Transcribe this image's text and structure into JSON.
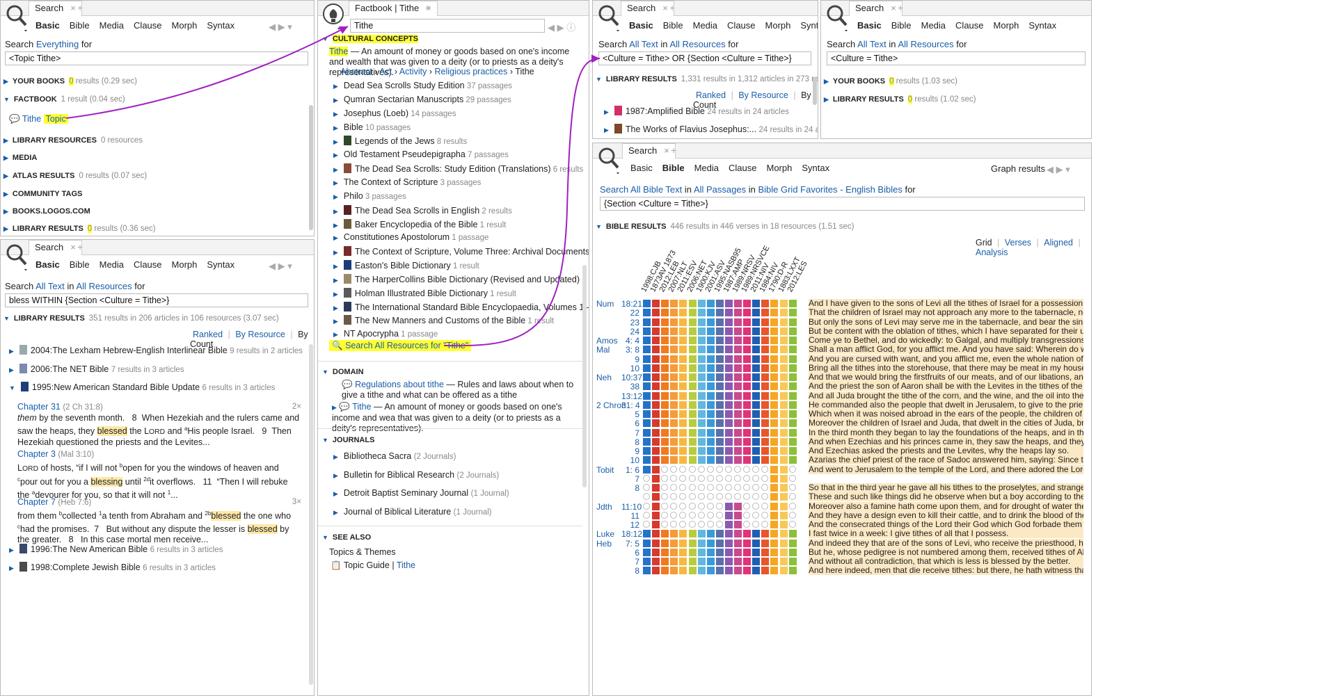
{
  "p1": {
    "tab": "Search",
    "subtabs": [
      "Basic",
      "Bible",
      "Media",
      "Clause",
      "Morph",
      "Syntax"
    ],
    "search_label": "Search",
    "scope": "Everything",
    "for": "for",
    "query": "<Topic Tithe>",
    "sections": [
      {
        "t": "YOUR BOOKS",
        "n": "0",
        "m": "results (0.29 sec)"
      },
      {
        "t": "FACTBOOK",
        "m": "1 result (0.04 sec)"
      },
      {
        "t": "LIBRARY RESOURCES",
        "m": "0 resources"
      },
      {
        "t": "MEDIA",
        "m": ""
      },
      {
        "t": "ATLAS RESULTS",
        "m": "0 results (0.07 sec)"
      },
      {
        "t": "COMMUNITY TAGS",
        "m": ""
      },
      {
        "t": "BOOKS.LOGOS.COM",
        "m": ""
      },
      {
        "t": "LIBRARY RESULTS",
        "n": "0",
        "m": "results (0.36 sec)"
      }
    ],
    "fact_item": "Tithe",
    "fact_type": "Topic"
  },
  "p2": {
    "tab": "Search",
    "subtabs": [
      "Basic",
      "Bible",
      "Media",
      "Clause",
      "Morph",
      "Syntax"
    ],
    "search_label": "Search",
    "scope1": "All Text",
    "in": "in",
    "scope2": "All Resources",
    "for": "for",
    "query": "bless WITHIN {Section <Culture = Tithe>}",
    "lib": "LIBRARY RESULTS",
    "lib_meta": "351 results in 206 articles in 106 resources (3.07 sec)",
    "sort": [
      "Ranked",
      "By Resource",
      "By Count"
    ],
    "books": [
      {
        "n": "2004:The Lexham Hebrew-English Interlinear Bible",
        "m": "9 results in 2 articles"
      },
      {
        "n": "2006:The NET Bible",
        "m": "7 results in 3 articles"
      },
      {
        "n": "1995:New American Standard Bible Update",
        "m": "6 results in 3 articles"
      }
    ],
    "c1_title": "Chapter 31",
    "c1_ref": "(2 Ch 31:8)",
    "c1_count": "2×",
    "c2_title": "Chapter 3",
    "c2_ref": "(Mal 3:10)",
    "c3_title": "Chapter 7",
    "c3_ref": "(Heb 7:6)",
    "c3_count": "3×",
    "books2": [
      {
        "n": "1996:The New American Bible",
        "m": "6 results in 3 articles"
      },
      {
        "n": "1998:Complete Jewish Bible",
        "m": "6 results in 3 articles"
      }
    ]
  },
  "p3": {
    "tab": "Factbook | Tithe",
    "query": "Tithe",
    "section": "CULTURAL CONCEPTS",
    "term": "Tithe",
    "def": "— An amount of money or goods based on one's income and wealth that was given to a deity (or to priests as a deity's representatives).",
    "crumbs": [
      "Abstract",
      "Act",
      "Activity",
      "Religious practices",
      "Tithe"
    ],
    "items": [
      {
        "n": "Dead Sea Scrolls Study Edition",
        "m": "37 passages",
        "i": ""
      },
      {
        "n": "Qumran Sectarian Manuscripts",
        "m": "29 passages",
        "i": ""
      },
      {
        "n": "Josephus (Loeb)",
        "m": "14 passages",
        "i": ""
      },
      {
        "n": "Bible",
        "m": "10 passages",
        "i": ""
      },
      {
        "n": "Legends of the Jews",
        "m": "8 results",
        "i": "#2e4a2a"
      },
      {
        "n": "Old Testament Pseudepigrapha",
        "m": "7 passages",
        "i": ""
      },
      {
        "n": "The Dead Sea Scrolls: Study Edition (Translations)",
        "m": "6 results",
        "i": "#8a4b3a"
      },
      {
        "n": "The Context of Scripture",
        "m": "3 passages",
        "i": ""
      },
      {
        "n": "Philo",
        "m": "3 passages",
        "i": ""
      },
      {
        "n": "The Dead Sea Scrolls in English",
        "m": "2 results",
        "i": "#5a2020"
      },
      {
        "n": "Baker Encyclopedia of the Bible",
        "m": "1 result",
        "i": "#6b5a3a"
      },
      {
        "n": "Constitutiones Apostolorum",
        "m": "1 passage",
        "i": ""
      },
      {
        "n": "The Context of Scripture, Volume Three: Archival Documents...",
        "m": "1 result",
        "i": "#7a2a2a"
      },
      {
        "n": "Easton's Bible Dictionary",
        "m": "1 result",
        "i": "#1a3a7a"
      },
      {
        "n": "The HarperCollins Bible Dictionary (Revised and Updated)",
        "m": "1 result",
        "i": "#9a8a6a"
      },
      {
        "n": "Holman Illustrated Bible Dictionary",
        "m": "1 result",
        "i": "#5a5a5a"
      },
      {
        "n": "The International Standard Bible Encyclopaedia, Volumes 1–5",
        "m": "1 result",
        "i": "#2a3a5a"
      },
      {
        "n": "The New Manners and Customs of the Bible",
        "m": "1 result",
        "i": "#6a5a4a"
      },
      {
        "n": "NT Apocrypha",
        "m": "1 passage",
        "i": ""
      }
    ],
    "search_all": "Search All Resources for \"Tithe\"",
    "domain": "DOMAIN",
    "dom1_t": "Regulations about tithe",
    "dom1_d": "— Rules and laws about when to give a tithe and what can be offered as a tithe",
    "dom2_t": "Tithe",
    "dom2_d": "— An amount of money or goods based on one's income and wea that was given to a deity (or to priests as a deity's representatives).",
    "journals": "JOURNALS",
    "jitems": [
      {
        "n": "Bibliotheca Sacra",
        "m": "(2 Journals)"
      },
      {
        "n": "Bulletin for Biblical Research",
        "m": "(2 Journals)"
      },
      {
        "n": "Detroit Baptist Seminary Journal",
        "m": "(1 Journal)"
      },
      {
        "n": "Journal of Biblical Literature",
        "m": "(1 Journal)"
      }
    ],
    "see_also": "SEE ALSO",
    "topics": "Topics & Themes",
    "tg": "Topic Guide",
    "tg_link": "Tithe"
  },
  "p4": {
    "tab": "Search",
    "subtabs": [
      "Basic",
      "Bible",
      "Media",
      "Clause",
      "Morph",
      "Syntax"
    ],
    "search_label": "Search",
    "scope1": "All Text",
    "in": "in",
    "scope2": "All Resources",
    "for": "for",
    "query": "<Culture = Tithe> OR {Section <Culture = Tithe>}",
    "lib": "LIBRARY RESULTS",
    "lib_meta": "1,331 results in 1,312 articles in 273 resources (4",
    "sort": [
      "Ranked",
      "By Resource",
      "By Count"
    ],
    "r1": "1987:Amplified Bible",
    "r1m": "24 results in 24 articles",
    "r2": "The Works of Flavius Josephus:...",
    "r2m": "24 results in 24 articles"
  },
  "p5": {
    "tab": "Search",
    "subtabs": [
      "Basic",
      "Bible",
      "Media",
      "Clause",
      "Morph",
      "Syntax"
    ],
    "search_label": "Search",
    "scope1": "All Text",
    "in": "in",
    "scope2": "All Resources",
    "for": "for",
    "query": "<Culture = Tithe>",
    "s1": "YOUR BOOKS",
    "s1n": "0",
    "s1m": "results (1.03 sec)",
    "s2": "LIBRARY RESULTS",
    "s2n": "0",
    "s2m": "results (1.02 sec)"
  },
  "p6": {
    "tab": "Search",
    "subtabs": [
      "Basic",
      "Bible",
      "Media",
      "Clause",
      "Morph",
      "Syntax"
    ],
    "graph": "Graph results",
    "search_all": "Search All Bible Text",
    "in": "in",
    "passages": "All Passages",
    "in2": "in",
    "favs": "Bible Grid Favorites - English Bibles",
    "for": "for",
    "query": "{Section <Culture = Tithe>}",
    "bible": "BIBLE RESULTS",
    "bible_meta": "446 results in 446 verses in 18 resources (1.51 sec)",
    "views": [
      "Grid",
      "Verses",
      "Aligned",
      "Analysis"
    ],
    "cols": [
      "1998:CJB",
      "1873AV 1873",
      "2012:LEB",
      "2007:NLT",
      "2011:ESV",
      "2006:NET",
      "1900:KJV",
      "2001:ASV",
      "1995:NASB95",
      "1987:AMP",
      "1989:NRSV",
      "1989:NRSVCE",
      "2011:NIV",
      "1984:NIV",
      "1790:D-R",
      "1883:LXXT",
      "2012:LES"
    ],
    "colors": [
      "#2473c8",
      "#d63a2f",
      "#f07a1e",
      "#f49b3a",
      "#f5b942",
      "#b8cc3e",
      "#62b7e0",
      "#3a9ad9",
      "#5b6fa8",
      "#8a5ab0",
      "#c84a8f",
      "#e0337a",
      "#1f5fb2",
      "#e8562a",
      "#f5a623",
      "#f7c95a",
      "#8dbf3a"
    ],
    "rows": [
      {
        "b": "Num",
        "r": "18:21",
        "t": "And I have given to the sons of Levi all the tithes of Israel for a possession, for the minis...",
        "m": ""
      },
      {
        "b": "",
        "r": "22",
        "t": "That the children of Israel may not approach any more to the tabernacle, nor commit d...",
        "m": ""
      },
      {
        "b": "",
        "r": "23",
        "t": "But only the sons of Levi may serve me in the tabernacle, and bear the sins of the peop...",
        "m": ""
      },
      {
        "b": "",
        "r": "24",
        "t": "But be content with the oblation of tithes, which I have separated for their uses and ne...",
        "m": ""
      },
      {
        "b": "Amos",
        "r": "4: 4",
        "t": "Come ye to Bethel, and do wickedly: to Galgal, and multiply transgressions: and bring i...",
        "m": ""
      },
      {
        "b": "Mal",
        "r": "3: 8",
        "t": "Shall a man afflict God, for you afflict me. And you have said: Wherein do we afflict the...",
        "m": ""
      },
      {
        "b": "",
        "r": "9",
        "t": "And you are cursed with want, and you afflict me, even the whole nation of you.",
        "m": ""
      },
      {
        "b": "",
        "r": "10",
        "t": "Bring all the tithes into the storehouse, that there may be meat in my house, and try m...",
        "m": ""
      },
      {
        "b": "Neh",
        "r": "10:37",
        "t": "And that we would bring the firstfruits of our meats, and of our libations, and the fruit...",
        "m": ""
      },
      {
        "b": "",
        "r": "38",
        "t": "And the priest the son of Aaron shall be with the Levites in the tithes of the Levites, and...",
        "m": ""
      },
      {
        "b": "",
        "r": "13:12",
        "t": "And all Juda brought the tithe of the corn, and the wine, and the oil into the storehous...",
        "m": ""
      },
      {
        "b": "2 Chron",
        "r": "31: 4",
        "t": "He commanded also the people that dwelt in Jerusalem, to give to the priests, and the...",
        "m": ""
      },
      {
        "b": "",
        "r": "5",
        "t": "Which when it was noised abroad in the ears of the people, the children of Israel offere...",
        "m": ""
      },
      {
        "b": "",
        "r": "6",
        "t": "Moreover the children of Israel and Juda, that dwelt in the cities of Juda, brought in th...",
        "m": ""
      },
      {
        "b": "",
        "r": "7",
        "t": "In the third month they began to lay the foundations of the heaps, and in the seventh...",
        "m": ""
      },
      {
        "b": "",
        "r": "8",
        "t": "And when Ezechias and his princes came in, they saw the heaps, and they blessed the...",
        "m": ""
      },
      {
        "b": "",
        "r": "9",
        "t": "And Ezechias asked the priests and the Levites, why the heaps lay so.",
        "m": ""
      },
      {
        "b": "",
        "r": "10",
        "t": "Azarias the chief priest of the race of Sadoc answered him, saying: Since the firstfruits...",
        "m": ""
      },
      {
        "b": "Tobit",
        "r": "1: 6",
        "t": "And went to Jerusalem to the temple of the Lord, and there adored the Lord God of Isr...",
        "m": "tobit6"
      },
      {
        "b": "",
        "r": "7",
        "t": "",
        "m": "tobit"
      },
      {
        "b": "",
        "r": "8",
        "t": "So that in the third year he gave all his tithes to the proselytes, and strangers.",
        "m": "tobit"
      },
      {
        "b": "",
        "r": "",
        "t": "These and such like things did he observe when but a boy according to the law of God.",
        "m": "tobit"
      },
      {
        "b": "Jdth",
        "r": "11:10",
        "t": "Moreover also a famine hath come upon them, and for drought of water they are alrea...",
        "m": "jdth"
      },
      {
        "b": "",
        "r": "11",
        "t": "And they have a design even to kill their cattle, and to drink the blood of them.",
        "m": "jdth"
      },
      {
        "b": "",
        "r": "12",
        "t": "And the consecrated things of the Lord their God which God forbade them to touch, in...",
        "m": "jdth"
      },
      {
        "b": "Luke",
        "r": "18:12",
        "t": "I fast twice in a week: I give tithes of all that I possess.",
        "m": ""
      },
      {
        "b": "Heb",
        "r": "7: 5",
        "t": "And indeed they that are of the sons of Levi, who receive the priesthood, have a comm...",
        "m": ""
      },
      {
        "b": "",
        "r": "6",
        "t": "But he, whose pedigree is not numbered among them, received tithes of Abraham and...",
        "m": ""
      },
      {
        "b": "",
        "r": "7",
        "t": "And without all contradiction, that which is less is blessed by the better.",
        "m": ""
      },
      {
        "b": "",
        "r": "8",
        "t": "And here indeed, men that die receive tithes: but there, he hath witness that he liveth.",
        "m": ""
      }
    ]
  }
}
